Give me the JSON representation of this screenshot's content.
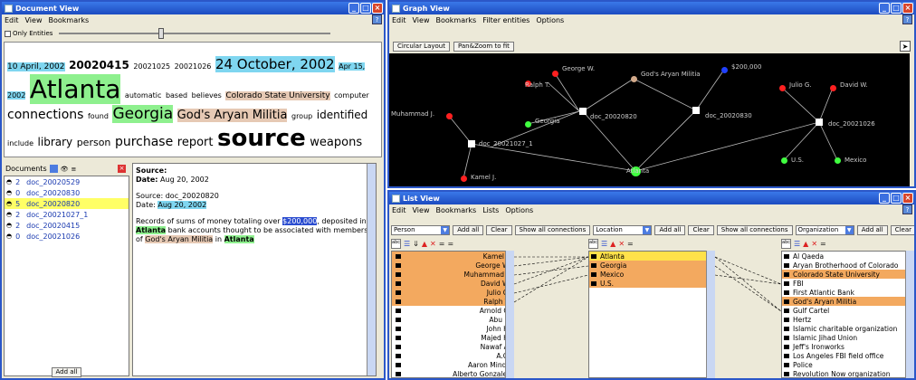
{
  "document_view": {
    "title": "Document View",
    "menu": [
      "Edit",
      "View",
      "Bookmarks"
    ],
    "slider_label": "Only Entities",
    "cloud": [
      {
        "t": "10 April, 2002",
        "s": 9,
        "hl": "blue"
      },
      {
        "t": "20020415",
        "s": 12,
        "bold": true
      },
      {
        "t": "20021025",
        "s": 8
      },
      {
        "t": "20021026",
        "s": 8
      },
      {
        "t": "24 October, 2002",
        "s": 15,
        "hl": "blue"
      },
      {
        "t": "Apr 15, 2002",
        "s": 8,
        "hl": "blue"
      },
      {
        "t": "Atlanta",
        "s": 28,
        "hl": "green"
      },
      {
        "t": "automatic",
        "s": 8
      },
      {
        "t": "based",
        "s": 8
      },
      {
        "t": "believes",
        "s": 8
      },
      {
        "t": "Colorado State University",
        "s": 9,
        "hl": "tan"
      },
      {
        "t": "computer",
        "s": 8
      },
      {
        "t": "connections",
        "s": 14
      },
      {
        "t": "found",
        "s": 8
      },
      {
        "t": "Georgia",
        "s": 17,
        "hl": "green"
      },
      {
        "t": "God's Aryan Militia",
        "s": 13,
        "hl": "tan"
      },
      {
        "t": "group",
        "s": 8
      },
      {
        "t": "identified",
        "s": 12
      },
      {
        "t": "include",
        "s": 8
      },
      {
        "t": "library",
        "s": 12
      },
      {
        "t": "person",
        "s": 11
      },
      {
        "t": "purchase",
        "s": 14
      },
      {
        "t": "report",
        "s": 13
      },
      {
        "t": "source",
        "s": 26,
        "bold": true
      },
      {
        "t": "weapons",
        "s": 13
      }
    ],
    "documents_label": "Documents",
    "documents": [
      {
        "count": "2",
        "name": "doc_20020529",
        "selected": false
      },
      {
        "count": "0",
        "name": "doc_20020830",
        "selected": false
      },
      {
        "count": "5",
        "name": "doc_20020820",
        "selected": true
      },
      {
        "count": "2",
        "name": "doc_20021027_1",
        "selected": false
      },
      {
        "count": "2",
        "name": "doc_20020415",
        "selected": false
      },
      {
        "count": "0",
        "name": "doc_20021026",
        "selected": false
      }
    ],
    "add_button": "Add all",
    "detail": {
      "source_label": "Source:",
      "date_label": "Date:",
      "date_value": "Aug 20, 2002",
      "source_line": "Source: doc_20020820",
      "date_line_prefix": "Date:",
      "date_line_value": "Aug 20, 2002",
      "body_1": "Records of sums of money totaling over",
      "body_money": "$200,000",
      "body_2": ", deposited in",
      "body_atlanta1": "Atlanta",
      "body_3": "bank accounts thought to be associated with members",
      "body_4": "of",
      "body_gam": "God's Aryan Militia",
      "body_5": "in",
      "body_atlanta2": "Atlanta"
    }
  },
  "graph_view": {
    "title": "Graph View",
    "menu": [
      "Edit",
      "View",
      "Bookmarks",
      "Filter entities",
      "Options"
    ],
    "btn_circular": "Circular Layout",
    "btn_zoom": "Pan&Zoom to fit",
    "nodes": [
      {
        "label": "George W.",
        "color": "#ff2020"
      },
      {
        "label": "Ralph T.",
        "color": "#ff2020"
      },
      {
        "label": "God's Aryan Militia",
        "color": "#d2a98a"
      },
      {
        "label": "$200,000",
        "color": "#2040ff"
      },
      {
        "label": "Julio G.",
        "color": "#ff2020"
      },
      {
        "label": "David W.",
        "color": "#ff2020"
      },
      {
        "label": "Muhammad J.",
        "color": "#ff2020"
      },
      {
        "label": "Georgia",
        "color": "#40ff40"
      },
      {
        "label": "doc_20020820",
        "color": "#ffffff"
      },
      {
        "label": "doc_20020830",
        "color": "#ffffff"
      },
      {
        "label": "doc_20021026",
        "color": "#ffffff"
      },
      {
        "label": "doc_20021027_1",
        "color": "#ffffff"
      },
      {
        "label": "U.S.",
        "color": "#40ff40"
      },
      {
        "label": "Mexico",
        "color": "#40ff40"
      },
      {
        "label": "Atlanta",
        "color": "#40ff40"
      },
      {
        "label": "Kamel J.",
        "color": "#ff2020"
      }
    ]
  },
  "list_view": {
    "title": "List View",
    "menu": [
      "Edit",
      "View",
      "Bookmarks",
      "Lists",
      "Options"
    ],
    "col1": {
      "select": "Person",
      "add_all": "Add all",
      "clear": "Clear",
      "show": "Show all connections",
      "items": [
        {
          "t": "Kamel J.",
          "c": "or"
        },
        {
          "t": "George W.",
          "c": "or"
        },
        {
          "t": "Muhammad J.",
          "c": "or"
        },
        {
          "t": "David W.",
          "c": "or"
        },
        {
          "t": "Julio G.",
          "c": "or"
        },
        {
          "t": "Ralph T.",
          "c": "or"
        },
        {
          "t": "Arnold C.",
          "c": ""
        },
        {
          "t": "Abu L.",
          "c": ""
        },
        {
          "t": "John H.",
          "c": ""
        },
        {
          "t": "Majed H.",
          "c": ""
        },
        {
          "t": "Nawaf A.",
          "c": ""
        },
        {
          "t": "A.G.",
          "c": ""
        },
        {
          "t": "Aaron Minde",
          "c": ""
        },
        {
          "t": "Alberto Gonzales",
          "c": ""
        }
      ]
    },
    "col2": {
      "select": "Location",
      "add_all": "Add all",
      "clear": "Clear",
      "show": "Show all connections",
      "items": [
        {
          "t": "Atlanta",
          "c": "ye"
        },
        {
          "t": "Georgia",
          "c": "or"
        },
        {
          "t": "Mexico",
          "c": "or"
        },
        {
          "t": "U.S.",
          "c": "or"
        }
      ]
    },
    "col3": {
      "select": "Organization",
      "add_all": "Add all",
      "clear": "Clear",
      "items": [
        {
          "t": "Al Qaeda",
          "c": ""
        },
        {
          "t": "Aryan Brotherhood of Colorado",
          "c": ""
        },
        {
          "t": "Colorado State University",
          "c": "or"
        },
        {
          "t": "FBI",
          "c": ""
        },
        {
          "t": "First Atlantic Bank",
          "c": ""
        },
        {
          "t": "God's Aryan Militia",
          "c": "or"
        },
        {
          "t": "Gulf Cartel",
          "c": ""
        },
        {
          "t": "Hertz",
          "c": ""
        },
        {
          "t": "Islamic charitable organization",
          "c": ""
        },
        {
          "t": "Islamic Jihad Union",
          "c": ""
        },
        {
          "t": "Jeff's Ironworks",
          "c": ""
        },
        {
          "t": "Los Angeles FBI field office",
          "c": ""
        },
        {
          "t": "Police",
          "c": ""
        },
        {
          "t": "Revolution Now organization",
          "c": ""
        }
      ]
    }
  }
}
